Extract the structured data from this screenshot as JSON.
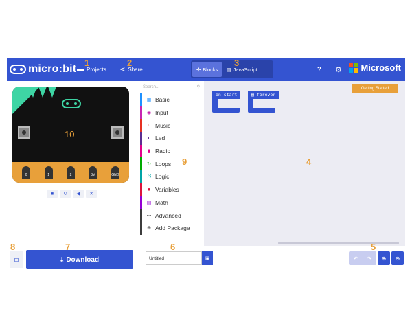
{
  "header": {
    "logo_text": "micro:bit",
    "projects_label": "Projects",
    "share_label": "Share",
    "blocks_label": "Blocks",
    "javascript_label": "JavaScript",
    "help_icon": "?",
    "gear_icon": "⚙",
    "microsoft_label": "Microsoft"
  },
  "annotations": {
    "n1": "1",
    "n2": "2",
    "n3": "3",
    "n4": "4",
    "n5": "5",
    "n6": "6",
    "n7": "7",
    "n8": "8",
    "n9": "9"
  },
  "simulator": {
    "display_value": "10",
    "pins": [
      "0",
      "1",
      "2",
      "3V",
      "GND"
    ]
  },
  "toolbox": {
    "search_placeholder": "Search...",
    "categories": [
      {
        "label": "Basic",
        "color": "#1e90ff",
        "icon": "▦"
      },
      {
        "label": "Input",
        "color": "#c724b1",
        "icon": "◉"
      },
      {
        "label": "Music",
        "color": "#e63022",
        "icon": "♫"
      },
      {
        "label": "Led",
        "color": "#5c2d91",
        "icon": "◐"
      },
      {
        "label": "Radio",
        "color": "#e3008c",
        "icon": "▮"
      },
      {
        "label": "Loops",
        "color": "#00aa00",
        "icon": "↻"
      },
      {
        "label": "Logic",
        "color": "#00a4a6",
        "icon": "⤨"
      },
      {
        "label": "Variables",
        "color": "#dc143c",
        "icon": "■"
      },
      {
        "label": "Math",
        "color": "#9400d3",
        "icon": "▤"
      },
      {
        "label": "Advanced",
        "color": "#3c3c3c",
        "icon": "⋯"
      },
      {
        "label": "Add Package",
        "color": "#3c3c3c",
        "icon": "⊕"
      }
    ]
  },
  "workspace": {
    "getting_started_label": "Getting Started",
    "on_start_label": "on start",
    "forever_label": "forever"
  },
  "bottom": {
    "download_label": "Download",
    "project_name": "Untitled"
  },
  "colors": {
    "header_blue": "#3454d1",
    "accent_orange": "#e8a03a",
    "board_green": "#3ed5a4"
  }
}
